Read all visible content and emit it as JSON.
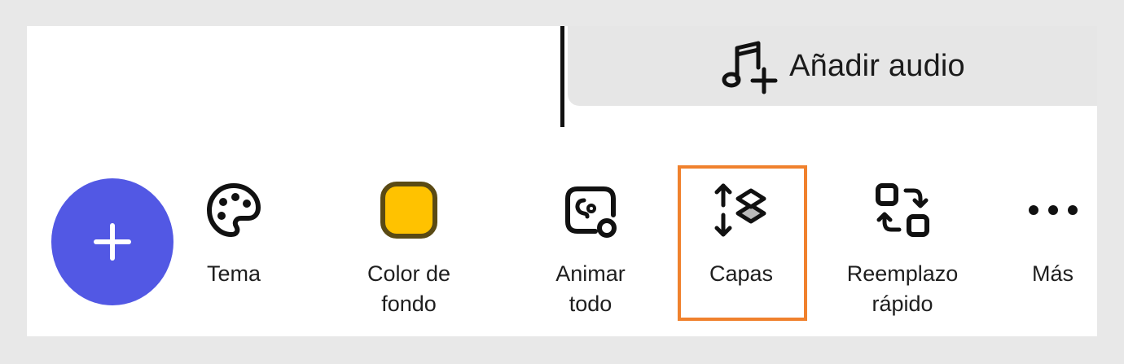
{
  "timeline": {
    "audio_button_label": "Añadir audio",
    "audio_icon": "music-note-add-icon"
  },
  "fab": {
    "icon": "plus-icon"
  },
  "toolbar": {
    "items": [
      {
        "label": "Tema",
        "icon": "palette-icon"
      },
      {
        "label": "Color de\nfondo",
        "icon": "color-swatch-icon",
        "swatch_color": "#ffc200"
      },
      {
        "label": "Animar\ntodo",
        "icon": "animate-icon"
      },
      {
        "label": "Capas",
        "icon": "layers-icon",
        "highlighted": true
      },
      {
        "label": "Reemplazo\nrápido",
        "icon": "swap-icon"
      },
      {
        "label": "Más",
        "icon": "more-icon"
      }
    ]
  },
  "colors": {
    "fab": "#5258e4",
    "highlight": "#f0812d",
    "background": "#e8e8e8"
  }
}
